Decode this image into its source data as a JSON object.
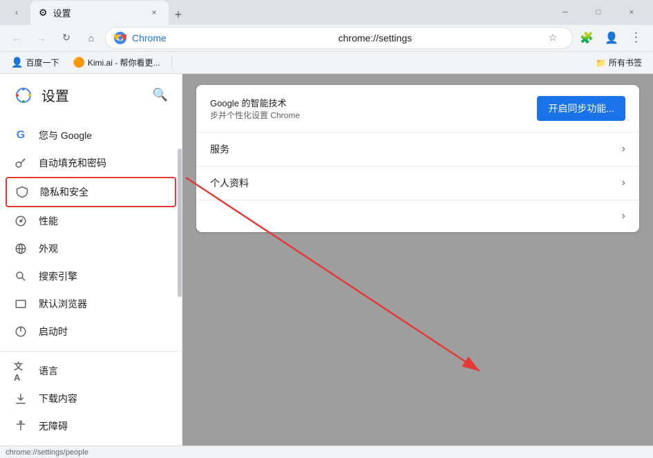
{
  "browser": {
    "tab": {
      "title": "设置",
      "favicon": "⚙",
      "close_label": "×"
    },
    "tab_new_label": "+",
    "window_controls": {
      "minimize": "─",
      "maximize": "□",
      "close": "×"
    },
    "address_bar": {
      "brand": "Chrome",
      "url": "chrome://settings",
      "favicon": "🌐"
    },
    "bookmarks": [
      {
        "label": "百度一下",
        "icon": "👤"
      },
      {
        "label": "Kimi.ai - 帮你看更...",
        "icon": "🟠"
      }
    ],
    "all_bookmarks_label": "所有书签",
    "status_url": "chrome://settings/people"
  },
  "sidebar": {
    "title": "设置",
    "search_icon": "search",
    "nav_items": [
      {
        "id": "google",
        "label": "您与 Google",
        "icon": "G"
      },
      {
        "id": "autofill",
        "label": "自动填充和密码",
        "icon": "🔑"
      },
      {
        "id": "privacy",
        "label": "隐私和安全",
        "icon": "🛡",
        "highlighted": true
      },
      {
        "id": "performance",
        "label": "性能",
        "icon": "⚡"
      },
      {
        "id": "appearance",
        "label": "外观",
        "icon": "🌐"
      },
      {
        "id": "search",
        "label": "搜索引擎",
        "icon": "🔍"
      },
      {
        "id": "browser",
        "label": "默认浏览器",
        "icon": "□"
      },
      {
        "id": "startup",
        "label": "启动时",
        "icon": "⏻"
      },
      {
        "id": "language",
        "label": "语言",
        "icon": "文"
      },
      {
        "id": "downloads",
        "label": "下载内容",
        "icon": "↓"
      },
      {
        "id": "accessibility",
        "label": "无障碍",
        "icon": "♿"
      }
    ]
  },
  "main": {
    "sync_card": {
      "description_line1": "Google 的智能技术",
      "description_line2": "步并个性化设置 Chrome",
      "sync_button_label": "开启同步功能...",
      "row1_label": "服务",
      "row2_label": "个人资料"
    }
  }
}
